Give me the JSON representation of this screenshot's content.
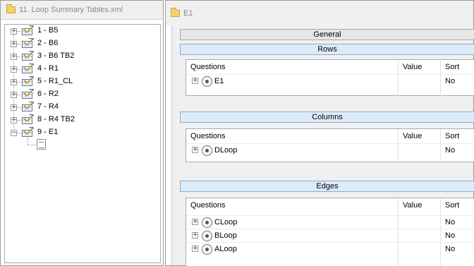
{
  "left": {
    "title": "11. Loop Summary Tables.xml",
    "items": [
      {
        "label": "1 - B5",
        "expander": "+"
      },
      {
        "label": "2 - B6",
        "expander": "+"
      },
      {
        "label": "3 - B6 TB2",
        "expander": "+"
      },
      {
        "label": "4 - R1",
        "expander": "+"
      },
      {
        "label": "5 - R1_CL",
        "expander": "+"
      },
      {
        "label": "6 - R2",
        "expander": "+"
      },
      {
        "label": "7 - R4",
        "expander": "+"
      },
      {
        "label": "8 - R4 TB2",
        "expander": "+"
      },
      {
        "label": "9 - E1",
        "expander": "−"
      }
    ]
  },
  "right": {
    "title": "E1",
    "general_label": "General",
    "sections": [
      {
        "label": "Rows",
        "headers": {
          "questions": "Questions",
          "value": "Value",
          "sort": "Sort"
        },
        "rows": [
          {
            "question": "E1",
            "sort": "No"
          }
        ]
      },
      {
        "label": "Columns",
        "headers": {
          "questions": "Questions",
          "value": "Value",
          "sort": "Sort"
        },
        "rows": [
          {
            "question": "DLoop",
            "sort": "No"
          }
        ]
      },
      {
        "label": "Edges",
        "headers": {
          "questions": "Questions",
          "value": "Value",
          "sort": "Sort"
        },
        "rows": [
          {
            "question": "CLoop",
            "sort": "No"
          },
          {
            "question": "BLoop",
            "sort": "No"
          },
          {
            "question": "ALoop",
            "sort": "No"
          }
        ]
      }
    ]
  },
  "icons": {
    "folder": "folder-icon",
    "table": "table-check-icon",
    "document": "document-icon",
    "expand": "plus-expander-icon",
    "collapse": "minus-expander-icon",
    "radio": "radio-icon"
  },
  "colors": {
    "section_bar": "#dcebf8",
    "section_border": "#84aed6",
    "panel_bg": "#f0f0f0"
  }
}
